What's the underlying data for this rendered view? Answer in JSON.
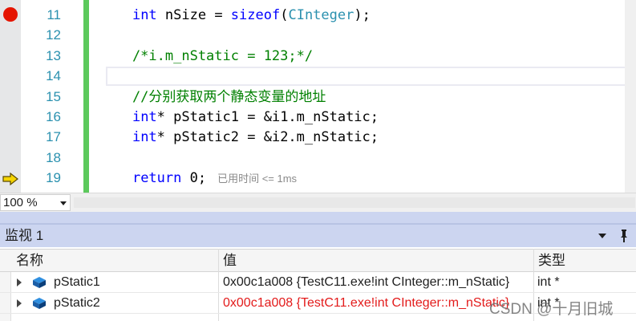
{
  "editor": {
    "lines": [
      {
        "number": "11",
        "segments": [
          {
            "text": "    ",
            "cls": ""
          },
          {
            "text": "int",
            "cls": "kw"
          },
          {
            "text": " nSize = ",
            "cls": ""
          },
          {
            "text": "sizeof",
            "cls": "kw"
          },
          {
            "text": "(",
            "cls": ""
          },
          {
            "text": "CInteger",
            "cls": "type"
          },
          {
            "text": ");",
            "cls": ""
          }
        ]
      },
      {
        "number": "12",
        "segments": []
      },
      {
        "number": "13",
        "segments": [
          {
            "text": "    /*i.m_nStatic = 123;*/",
            "cls": "cmt"
          }
        ]
      },
      {
        "number": "14",
        "segments": []
      },
      {
        "number": "15",
        "segments": [
          {
            "text": "    //分别获取两个静态变量的地址",
            "cls": "cmt"
          }
        ]
      },
      {
        "number": "16",
        "segments": [
          {
            "text": "    ",
            "cls": ""
          },
          {
            "text": "int",
            "cls": "kw"
          },
          {
            "text": "* pStatic1 = &i1.m_nStatic;",
            "cls": ""
          }
        ]
      },
      {
        "number": "17",
        "segments": [
          {
            "text": "    ",
            "cls": ""
          },
          {
            "text": "int",
            "cls": "kw"
          },
          {
            "text": "* pStatic2 = &i2.m_nStatic;",
            "cls": ""
          }
        ]
      },
      {
        "number": "18",
        "segments": []
      },
      {
        "number": "19",
        "segments": [
          {
            "text": "    ",
            "cls": ""
          },
          {
            "text": "return",
            "cls": "kw"
          },
          {
            "text": " 0;",
            "cls": ""
          }
        ]
      }
    ],
    "perf_tip": "已用时间 <= 1ms"
  },
  "zoom": {
    "value": "100 %"
  },
  "watch": {
    "title": "监视 1",
    "columns": {
      "name": "名称",
      "value": "值",
      "type": "类型"
    },
    "rows": [
      {
        "name": "pStatic1",
        "value": "0x00c1a008 {TestC11.exe!int CInteger::m_nStatic}",
        "type": "int *",
        "changed": false
      },
      {
        "name": "pStatic2",
        "value": "0x00c1a008 {TestC11.exe!int CInteger::m_nStatic}",
        "type": "int *",
        "changed": true
      }
    ]
  },
  "watermark": "CSDN @十月旧城",
  "colors": {
    "breakpoint": "#e51400",
    "changed_value": "#e31b1b",
    "panel_header": "#ccd5f0"
  }
}
